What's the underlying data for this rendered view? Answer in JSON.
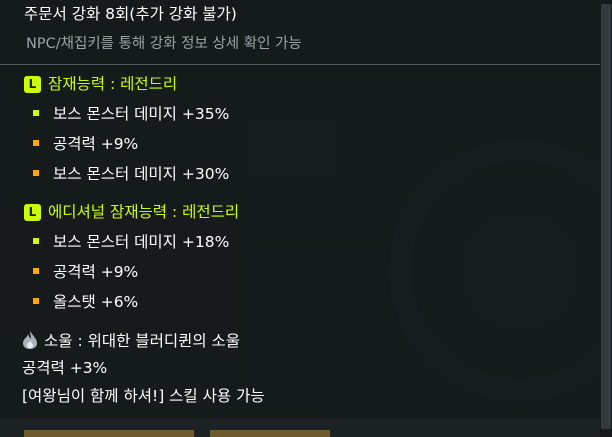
{
  "item": {
    "upgrade_title": "주문서 강화 8회(추가 강화 불가)",
    "upgrade_hint": "NPC/채집키를 통해 강화 정보 상세 확인 가능"
  },
  "potential": {
    "badge": "L",
    "title": "잠재능력 : 레전드리",
    "grade_color": "#ccff00",
    "options": [
      {
        "text": "보스 몬스터 데미지 +35%",
        "bullet_color": "#ccff00"
      },
      {
        "text": "공격력 +9%",
        "bullet_color": "#ffaa00"
      },
      {
        "text": "보스 몬스터 데미지 +30%",
        "bullet_color": "#ffaa00"
      }
    ]
  },
  "additional_potential": {
    "badge": "L",
    "title": "에디셔널 잠재능력 : 레전드리",
    "options": [
      {
        "text": "보스 몬스터 데미지 +18%",
        "bullet_color": "#ccff00"
      },
      {
        "text": "공격력 +9%",
        "bullet_color": "#ffaa00"
      },
      {
        "text": "올스탯 +6%",
        "bullet_color": "#ffaa00"
      }
    ]
  },
  "soul": {
    "icon": "soul-flame-icon",
    "title": "소울 : 위대한 블러디퀸의 소울",
    "stat": "공격력 +3%",
    "skill": "[여왕님이 함께 하셔!] 스킬 사용 가능"
  }
}
